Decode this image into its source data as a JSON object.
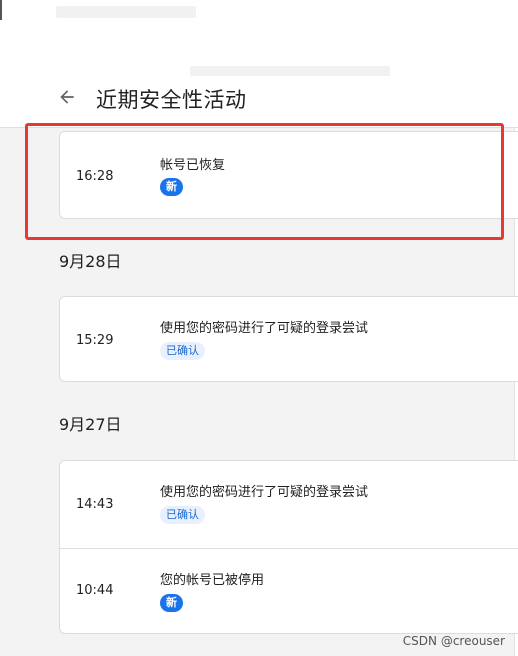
{
  "header": {
    "title": "近期安全性活动"
  },
  "groups": [
    {
      "date": "",
      "events": [
        {
          "time": "16:28",
          "title": "帐号已恢复",
          "badge": "新",
          "badge_kind": "new"
        }
      ]
    },
    {
      "date": "9月28日",
      "events": [
        {
          "time": "15:29",
          "title": "使用您的密码进行了可疑的登录尝试",
          "badge": "已确认",
          "badge_kind": "confirmed"
        }
      ]
    },
    {
      "date": "9月27日",
      "events": [
        {
          "time": "14:43",
          "title": "使用您的密码进行了可疑的登录尝试",
          "badge": "已确认",
          "badge_kind": "confirmed"
        },
        {
          "time": "10:44",
          "title": "您的帐号已被停用",
          "badge": "新",
          "badge_kind": "new"
        }
      ]
    }
  ],
  "watermark": "CSDN @creouser",
  "colors": {
    "accent": "#1a73e8",
    "badge_confirmed_bg": "#e8f0fe",
    "highlight": "#e53935"
  },
  "icons": {
    "back": "arrow-left-icon"
  }
}
